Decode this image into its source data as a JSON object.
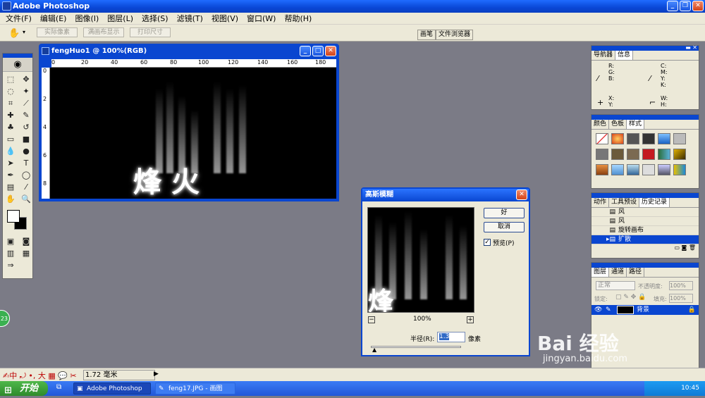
{
  "app": {
    "title": "Adobe Photoshop"
  },
  "menu": [
    "文件(F)",
    "编辑(E)",
    "图像(I)",
    "图层(L)",
    "选择(S)",
    "滤镜(T)",
    "视图(V)",
    "窗口(W)",
    "帮助(H)"
  ],
  "options": {
    "actual_pixels": "实际像素",
    "fit_on_screen": "满画布显示",
    "print_size": "打印尺寸",
    "tabs": [
      "画笔",
      "文件浏览器"
    ]
  },
  "document": {
    "title": "fengHuo1 @ 100%(RGB)",
    "ruler_h": [
      "0",
      "20",
      "40",
      "60",
      "80",
      "100",
      "120",
      "140",
      "160",
      "180"
    ],
    "ruler_v": [
      "0",
      "2",
      "4",
      "6",
      "8"
    ],
    "text": "烽火"
  },
  "dialog": {
    "title": "高斯模糊",
    "ok": "好",
    "cancel": "取消",
    "preview_label": "预览(P)",
    "preview_checked": true,
    "zoom": "100%",
    "radius_label": "半径(R):",
    "radius_value": "1.3",
    "radius_unit": "像素"
  },
  "navigator_panel": {
    "tabs": [
      "导航器",
      "信息"
    ],
    "active": "信息",
    "left_labels": "R:\nG:\nB:",
    "right_labels": "C:\nM:\nY:\nK:",
    "xy": "X:\nY:",
    "wh": "W:\nH:"
  },
  "color_panel": {
    "tabs": [
      "颜色",
      "色板",
      "样式"
    ],
    "active": "样式"
  },
  "history_panel": {
    "tabs": [
      "动作",
      "工具预设",
      "历史记录"
    ],
    "active": "历史记录",
    "items": [
      "风",
      "风",
      "旋转画布",
      "扩散"
    ],
    "active_index": 3
  },
  "layers_panel": {
    "tabs": [
      "图层",
      "通道",
      "路径"
    ],
    "active": "图层",
    "blend_mode": "正常",
    "opacity_label": "不透明度:",
    "opacity_value": "100%",
    "lock_label": "锁定:",
    "fill_label": "填充:",
    "fill_value": "100%",
    "layer_name": "背景"
  },
  "status": {
    "value": "1.72 毫米",
    "badge": "23"
  },
  "taskbar": {
    "start": "开始",
    "items": [
      "Adobe Photoshop",
      "feng17.JPG - 画图"
    ],
    "time": "10:45"
  },
  "watermark": {
    "logo": "Bai  经验",
    "url": "jingyan.baidu.com"
  },
  "colors": {
    "titlebar": "#0a46d0",
    "workspace": "#7b7b86",
    "panel": "#ece9d8",
    "taskbar": "#2257d8"
  }
}
